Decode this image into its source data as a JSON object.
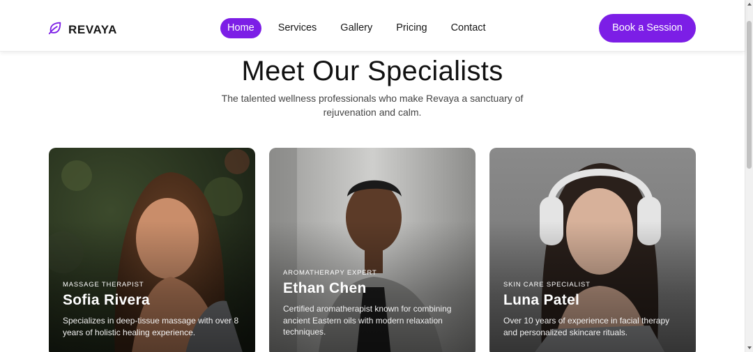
{
  "brand": {
    "name": "REVAYA",
    "icon": "leaf-icon",
    "accent": "#7c1ee6"
  },
  "nav": {
    "items": [
      {
        "label": "Home",
        "active": true
      },
      {
        "label": "Services",
        "active": false
      },
      {
        "label": "Gallery",
        "active": false
      },
      {
        "label": "Pricing",
        "active": false
      },
      {
        "label": "Contact",
        "active": false
      }
    ]
  },
  "cta": {
    "label": "Book a Session"
  },
  "section": {
    "title": "Meet Our Specialists",
    "subtitle": "The talented wellness professionals who make Revaya a sanctuary of rejuvenation and calm."
  },
  "specialists": [
    {
      "role": "Massage Therapist",
      "name": "Sofia Rivera",
      "bio": "Specializes in deep-tissue massage with over 8 years of holistic healing experience."
    },
    {
      "role": "Aromatherapy Expert",
      "name": "Ethan Chen",
      "bio": "Certified aromatherapist known for combining ancient Eastern oils with modern relaxation techniques."
    },
    {
      "role": "Skin Care Specialist",
      "name": "Luna Patel",
      "bio": "Over 10 years of experience in facial therapy and personalized skincare rituals."
    }
  ]
}
